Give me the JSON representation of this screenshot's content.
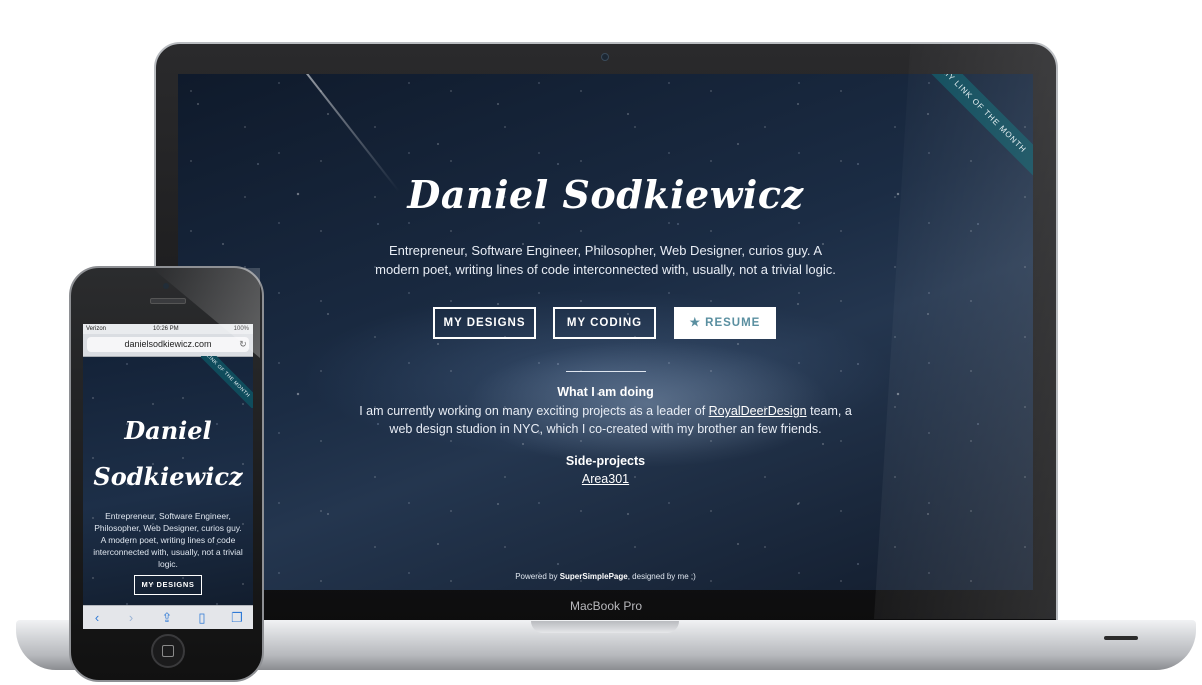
{
  "laptop": {
    "model_label": "MacBook Pro",
    "site": {
      "ribbon": "MY LINK OF THE MONTH",
      "name": "Daniel Sodkiewicz",
      "tagline": "Entrepreneur, Software Engineer, Philosopher, Web Designer, curios guy. A modern poet, writing lines of code interconnected with, usually, not a trivial logic.",
      "buttons": {
        "designs": "MY DESIGNS",
        "coding": "MY CODING",
        "resume": "★ RESUME"
      },
      "doing": {
        "heading": "What I am doing",
        "text_before": "I am currently working on many exciting projects as a leader of ",
        "link": "RoyalDeerDesign",
        "text_after": " team, a web design studion in NYC, which I co-created with my brother an few friends."
      },
      "side": {
        "heading": "Side-projects",
        "link": "Area301"
      },
      "footer": {
        "prefix": "Powered by ",
        "brand": "SuperSimplePage",
        "suffix": ", designed by me ;)"
      }
    }
  },
  "phone": {
    "status": {
      "carrier": "Verizon",
      "time": "10:26 PM",
      "battery": "100%"
    },
    "url": "danielsodkiewicz.com",
    "site": {
      "ribbon": "LINK OF THE MONTH",
      "name_line1": "Daniel",
      "name_line2": "Sodkiewicz",
      "tagline": "Entrepreneur, Software Engineer, Philosopher, Web Designer, curios guy. A modern poet, writing lines of code interconnected with, usually, not a trivial logic.",
      "button": "MY DESIGNS"
    },
    "toolbar_icons": [
      "back-icon",
      "forward-icon",
      "share-icon",
      "bookmarks-icon",
      "tabs-icon"
    ]
  },
  "colors": {
    "ribbon": "#0f4c5c",
    "resume_text": "#5a8fa0",
    "sky_dark": "#0f1a2b"
  }
}
